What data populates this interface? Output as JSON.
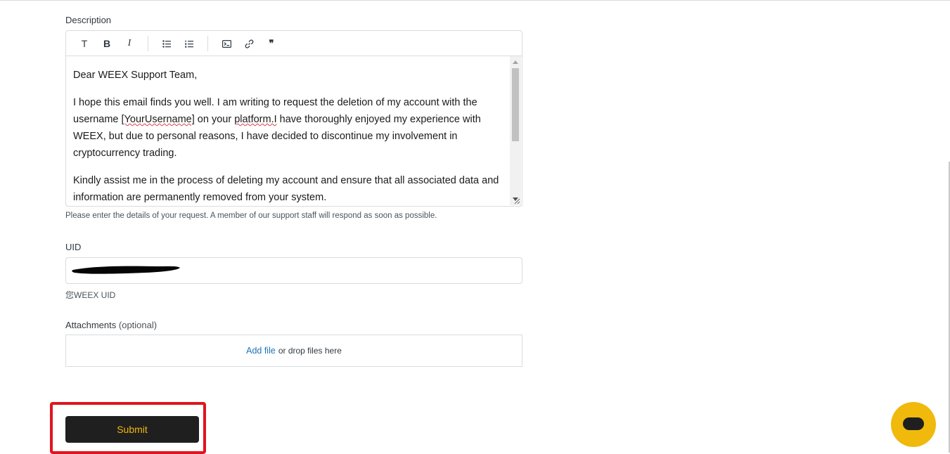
{
  "description": {
    "label": "Description",
    "toolbar": {
      "text_label": "T",
      "bold_label": "B",
      "italic_label": "I",
      "quote_label": "❞"
    },
    "paragraphs": {
      "p1": "Dear WEEX Support Team,",
      "p2_a": "I hope this email finds you well. I am writing to request the deletion of my account with the username ",
      "p2_username": "[YourUsername]",
      "p2_b": " on your ",
      "p2_platform": "platform.I",
      "p2_c": " have thoroughly enjoyed my experience with WEEX, but due to personal reasons, I have decided to discontinue my involvement in cryptocurrency trading.",
      "p3": "Kindly assist me in the process of deleting my account and ensure that all associated data and information are permanently removed from your system."
    },
    "hint": "Please enter the details of your request. A member of our support staff will respond as soon as possible."
  },
  "uid": {
    "label": "UID",
    "hint": "您WEEX UID"
  },
  "attachments": {
    "label": "Attachments",
    "optional": "(optional)",
    "add_file": "Add file",
    "drop_text": "or drop files here"
  },
  "submit_label": "Submit",
  "colors": {
    "accent": "#f0b90b",
    "highlight": "#e0141e",
    "link": "#1f73b7",
    "button_bg": "#1f1f1f"
  }
}
